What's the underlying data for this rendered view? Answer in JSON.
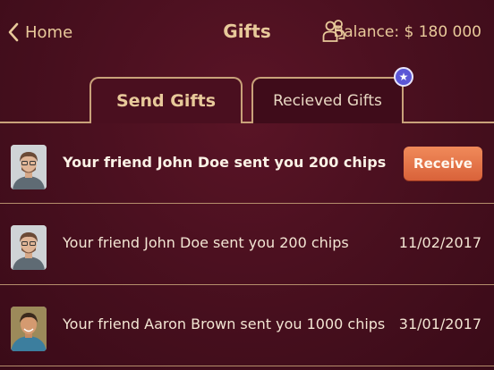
{
  "header": {
    "back_label": "Home",
    "title": "Gifts",
    "balance": "Balance: $ 180 000"
  },
  "tabs": [
    {
      "label": "Send Gifts",
      "active": false
    },
    {
      "label": "Recieved Gifts",
      "active": true
    }
  ],
  "gifts": [
    {
      "text": "Your friend John Doe sent you 200 chips",
      "action_label": "Receive",
      "date": ""
    },
    {
      "text": "Your friend John Doe sent you 200 chips",
      "action_label": "",
      "date": "11/02/2017"
    },
    {
      "text": "Your friend Aaron Brown sent you 1000 chips",
      "action_label": "",
      "date": "31/01/2017"
    }
  ],
  "colors": {
    "background": "#470f1e",
    "gold": "#e8c99a",
    "receive_button": "#e8744a",
    "badge": "#5b57d6"
  },
  "icons": [
    "chevron-left-icon",
    "friends-icon",
    "star-icon"
  ]
}
